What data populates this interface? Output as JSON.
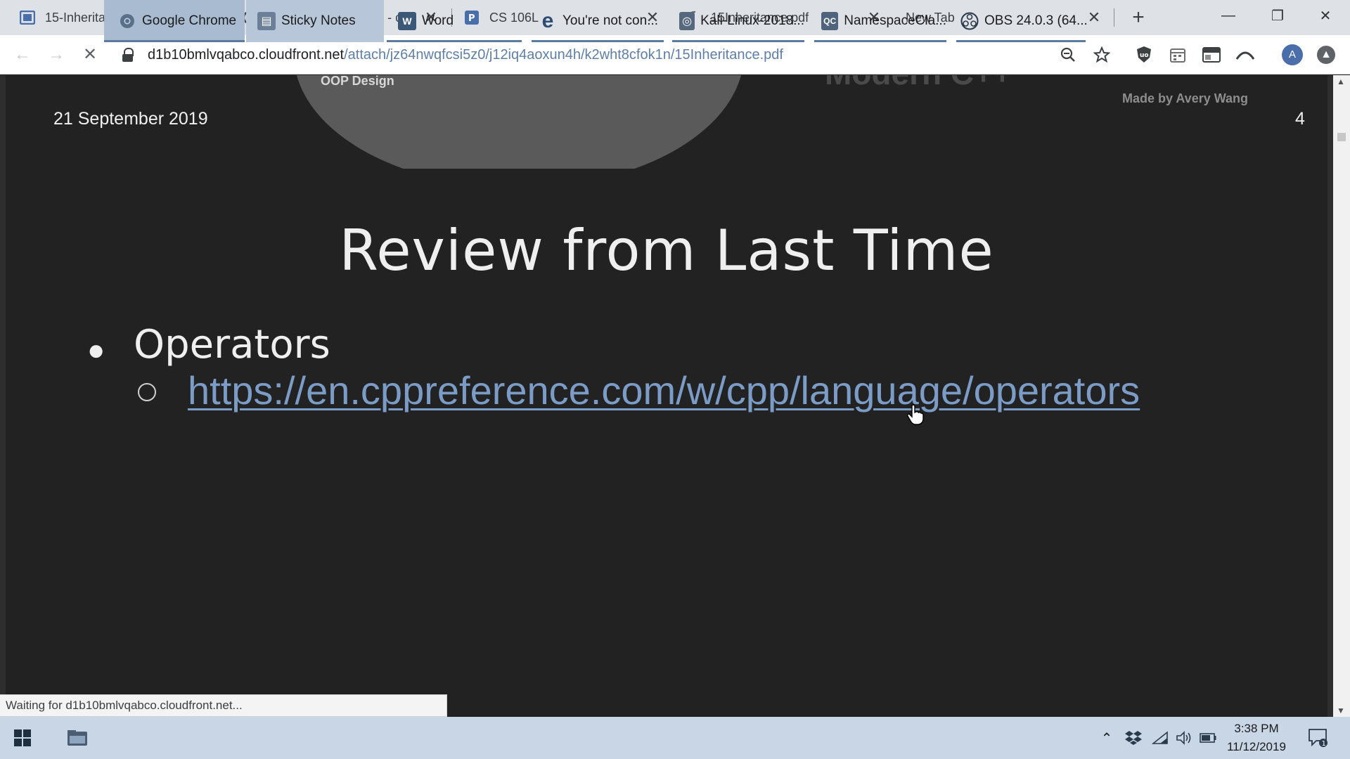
{
  "browser": {
    "tabs": [
      {
        "title": "15-Inheritance - Google Sli",
        "icon": "slides-icon"
      },
      {
        "title": "operator overloading - cpp",
        "icon": "cppreference-icon"
      },
      {
        "title": "CS 106L",
        "icon": "piazza-icon"
      },
      {
        "title": "15Inheritance.pdf",
        "icon": "loading-spinner-icon"
      },
      {
        "title": "New Tab",
        "icon": ""
      }
    ],
    "close_glyph": "✕",
    "new_tab_glyph": "+",
    "window_controls": {
      "minimize": "—",
      "restore": "❐",
      "close": "✕"
    },
    "url_host": "d1b10bmlvqabco.cloudfront.net",
    "url_path": "/attach/jz64nwqfcsi5z0/j12iq4aoxun4h/k2wht8cfok1n/15Inheritance.pdf",
    "avatar_letter": "A",
    "status_text": "Waiting for d1b10bmlvqabco.cloudfront.net..."
  },
  "pdf": {
    "previous_page": {
      "ood_text": "OOP Design",
      "modern_text": "Modern C++",
      "made_by": "Made by Avery Wang",
      "date": "21 September 2019",
      "page_number": "4"
    },
    "current_page": {
      "title": "Review from Last Time",
      "bullet": "Operators",
      "link": "https://en.cppreference.com/w/cpp/language/operators"
    }
  },
  "taskbar": {
    "items": [
      {
        "label": "Google Chrome",
        "icon": "chrome-icon"
      },
      {
        "label": "Sticky Notes",
        "icon": "sticky-notes-icon"
      },
      {
        "label": "Word",
        "icon": "word-icon"
      },
      {
        "label": "You're not con...",
        "icon": "edge-icon"
      },
      {
        "label": "Kali-Linux-2018...",
        "icon": "vmware-icon"
      },
      {
        "label": "NamespaceCla...",
        "icon": "qt-creator-icon"
      },
      {
        "label": "OBS 24.0.3 (64...",
        "icon": "obs-icon"
      }
    ],
    "time": "3:38 PM",
    "date": "11/12/2019",
    "notification_count": "1"
  }
}
